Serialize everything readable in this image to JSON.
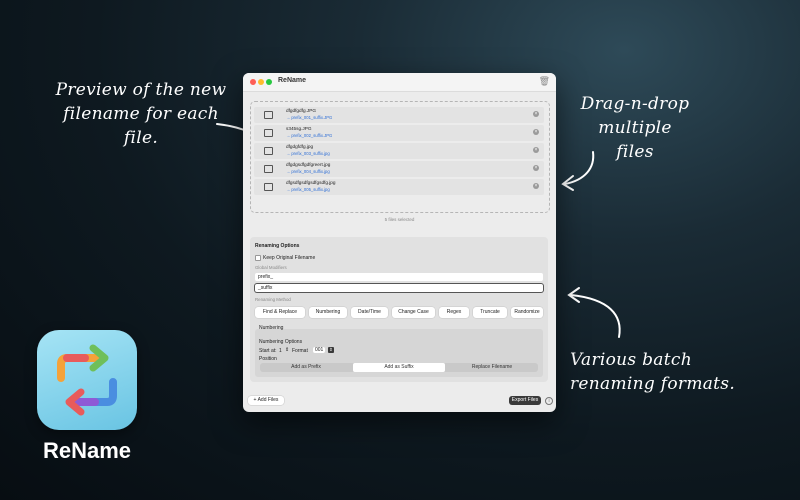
{
  "captions": {
    "preview": [
      "Preview of the new",
      "filename for each file."
    ],
    "dragdrop": [
      "Drag-n-drop",
      "multiple files"
    ],
    "formats": [
      "Various batch",
      "renaming formats."
    ]
  },
  "app": {
    "name": "ReName",
    "window_title": "ReName"
  },
  "files": [
    {
      "name": "dfgdfgdfg.JPG",
      "new": "→ prefix_001_suffix.JPG"
    },
    {
      "name": "s345sg.JPG",
      "new": "→ prefix_002_suffix.JPG"
    },
    {
      "name": "dfgdgfdfg.jpg",
      "new": "→ prefix_003_suffix.jpg"
    },
    {
      "name": "dfgdgsdfgdfgreert.jpg",
      "new": "→ prefix_004_suffix.jpg"
    },
    {
      "name": "dfgsdfgsdfgsdfgsdfg.jpg",
      "new": "→ prefix_005_suffix.jpg"
    }
  ],
  "files_selected": "5 files selected",
  "options": {
    "title": "Renaming Options",
    "keep_original": "Keep Original Filename",
    "global_modifiers": "Global Modifiers",
    "prefix_value": "prefix_",
    "suffix_value": "_suffix",
    "method_label": "Renaming Method",
    "methods": [
      "Find & Replace",
      "Numbering",
      "Date/Time",
      "Change Case",
      "Regex",
      "Truncate",
      "Randomize"
    ],
    "numbering": {
      "title": "Numbering",
      "options_label": "Numbering Options",
      "start_label": "Start at:",
      "start_value": "1",
      "format_label": "Format",
      "format_value": "001",
      "position_label": "Position",
      "positions": [
        "Add as Prefix",
        "Add as Suffix",
        "Replace Filename"
      ],
      "active_position": "Add as Suffix"
    }
  },
  "footer": {
    "add_files": "Add Files",
    "export_files": "Export Files",
    "add_icon": "plus-icon",
    "info_icon": "info-icon"
  },
  "colors": {
    "accent": "#2f6fd6",
    "export_bg": "#3a3a3a",
    "icon_bg": "#8fd6ee"
  }
}
